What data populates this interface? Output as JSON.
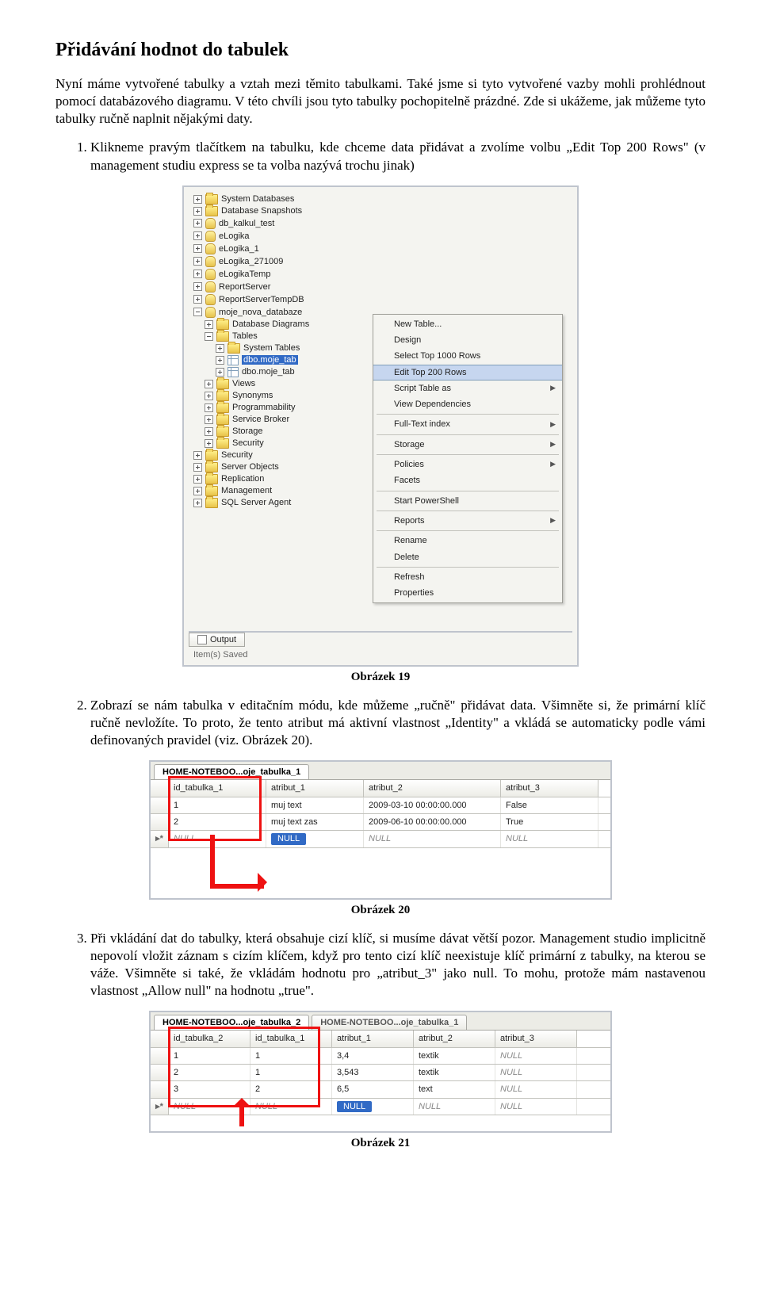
{
  "heading": "Přidávání hodnot do tabulek",
  "intro": "Nyní máme vytvořené tabulky a vztah mezi těmito tabulkami. Také jsme si tyto vytvořené vazby mohli prohlédnout pomocí databázového diagramu. V této chvíli jsou tyto tabulky pochopitelně prázdné. Zde si ukážeme, jak můžeme tyto tabulky ručně naplnit nějakými daty.",
  "li1": "Klikneme pravým tlačítkem na tabulku, kde chceme data přidávat a zvolíme volbu „Edit Top 200 Rows\" (v management studiu express se ta volba nazývá trochu jinak)",
  "li2": "Zobrazí se nám tabulka v editačním módu, kde můžeme „ručně\" přidávat data. Všimněte si, že primární klíč ručně nevložíte. To proto, že tento atribut má aktivní vlastnost „Identity\" a vkládá se automaticky podle vámi definovaných pravidel (viz. Obrázek 20).",
  "li3": "Při vkládání dat do tabulky, která obsahuje cizí klíč, si musíme dávat větší pozor. Management studio implicitně nepovolí vložit záznam s cizím klíčem, když pro tento cizí klíč neexistuje klíč primární z tabulky, na kterou se váže. Všimněte si také, že vkládám hodnotu pro „atribut_3\" jako null. To mohu, protože mám nastavenou vlastnost „Allow null\" na hodnotu „true\".",
  "cap19": "Obrázek 19",
  "cap20": "Obrázek 20",
  "cap21": "Obrázek 21",
  "tree": {
    "sys_db": "System Databases",
    "snap": "Database Snapshots",
    "kalkul": "db_kalkul_test",
    "elog": "eLogika",
    "elog1": "eLogika_1",
    "elog27": "eLogika_271009",
    "elogT": "eLogikaTemp",
    "rep": "ReportServer",
    "repT": "ReportServerTempDB",
    "moje": "moje_nova_databaze",
    "dd": "Database Diagrams",
    "tables": "Tables",
    "syst": "System Tables",
    "t1": "dbo.moje_tab",
    "t2": "dbo.moje_tab",
    "views": "Views",
    "syn": "Synonyms",
    "prog": "Programmability",
    "sb": "Service Broker",
    "stor": "Storage",
    "sec": "Security",
    "sec2": "Security",
    "so": "Server Objects",
    "repl": "Replication",
    "mgmt": "Management",
    "agent": "SQL Server Agent",
    "output": "Output",
    "status": "Item(s) Saved"
  },
  "menu": {
    "new": "New Table...",
    "design": "Design",
    "sel1000": "Select Top 1000 Rows",
    "edit200": "Edit Top 200 Rows",
    "script": "Script Table as",
    "viewd": "View Dependencies",
    "fti": "Full-Text index",
    "stor": "Storage",
    "pol": "Policies",
    "facets": "Facets",
    "ps": "Start PowerShell",
    "rep": "Reports",
    "ren": "Rename",
    "del": "Delete",
    "ref": "Refresh",
    "prop": "Properties"
  },
  "fig20": {
    "tab": "HOME-NOTEBOO...oje_tabulka_1",
    "hdr": [
      "id_tabulka_1",
      "atribut_1",
      "atribut_2",
      "atribut_3"
    ],
    "row1": [
      "1",
      "muj text",
      "2009-03-10 00:00:00.000",
      "False"
    ],
    "row2": [
      "2",
      "muj text zas",
      "2009-06-10 00:00:00.000",
      "True"
    ],
    "null": "NULL",
    "star": "▸*"
  },
  "fig21": {
    "tab_a": "HOME-NOTEBOO...oje_tabulka_2",
    "tab_b": "HOME-NOTEBOO...oje_tabulka_1",
    "hdr": [
      "id_tabulka_2",
      "id_tabulka_1",
      "atribut_1",
      "atribut_2",
      "atribut_3"
    ],
    "rows": [
      [
        "1",
        "1",
        "3,4",
        "textik",
        "NULL"
      ],
      [
        "2",
        "1",
        "3,543",
        "textik",
        "NULL"
      ],
      [
        "3",
        "2",
        "6,5",
        "text",
        "NULL"
      ]
    ],
    "null": "NULL"
  }
}
